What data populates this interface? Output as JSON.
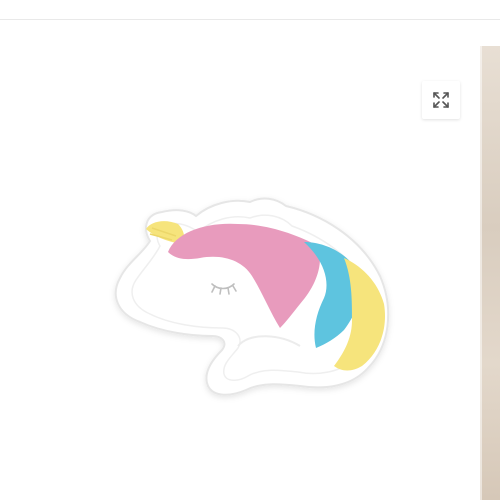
{
  "product_gallery": {
    "main_image_alt": "",
    "fullscreen_icon": "expand-arrows-icon",
    "colors": {
      "pink": "#e89bbd",
      "blue": "#5ec4df",
      "yellow": "#f6e47c",
      "body": "#ffffff",
      "outline": "#e7e7e7"
    }
  }
}
